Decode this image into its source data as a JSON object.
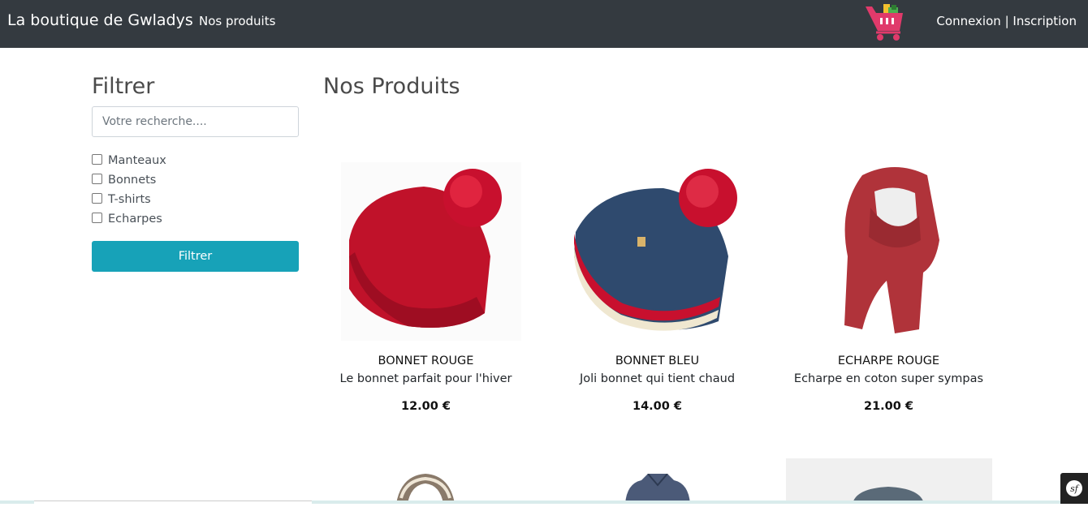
{
  "navbar": {
    "brand": "La boutique de Gwladys",
    "nav_link": "Nos produits",
    "cart_icon": "shopping-cart-icon",
    "login": "Connexion",
    "separator": "|",
    "register": "Inscription"
  },
  "sidebar": {
    "title": "Filtrer",
    "search_placeholder": "Votre recherche....",
    "categories": [
      "Manteaux",
      "Bonnets",
      "T-shirts",
      "Echarpes"
    ],
    "filter_button": "Filtrer"
  },
  "main": {
    "title": "Nos Produits",
    "products": [
      {
        "name": "BONNET ROUGE",
        "description": "Le bonnet parfait pour l'hiver",
        "price": "12.00 €"
      },
      {
        "name": "BONNET BLEU",
        "description": "Joli bonnet qui tient chaud",
        "price": "14.00 €"
      },
      {
        "name": "ECHARPE ROUGE",
        "description": "Echarpe en coton super sympas",
        "price": "21.00 €"
      }
    ]
  },
  "colors": {
    "navbar": "#343a40",
    "filter_button": "#17a2b8",
    "cart": "#e03a6b"
  },
  "debug_toolbar_icon": "symfony-icon"
}
